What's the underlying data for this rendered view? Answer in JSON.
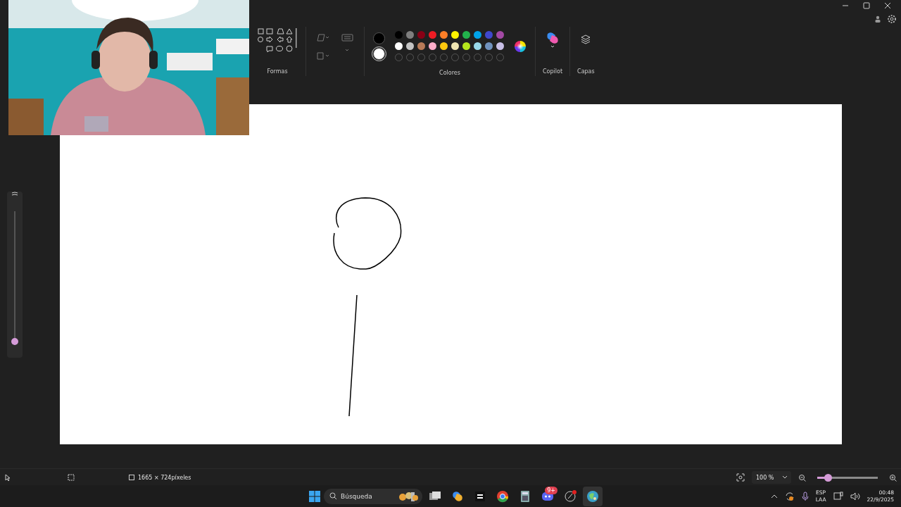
{
  "ribbon": {
    "shapes": {
      "label": "Formas"
    },
    "colors": {
      "label": "Colores",
      "current": [
        {
          "color": "#000000"
        },
        {
          "color": "#ffffff"
        }
      ],
      "palette": [
        {
          "color": "#000000"
        },
        {
          "color": "#7f7f7f"
        },
        {
          "color": "#880015"
        },
        {
          "color": "#ed1c24"
        },
        {
          "color": "#ff7f27"
        },
        {
          "color": "#fff200"
        },
        {
          "color": "#22b14c"
        },
        {
          "color": "#00a2e8"
        },
        {
          "color": "#3f48cc"
        },
        {
          "color": "#a349a4"
        },
        {
          "color": "#ffffff"
        },
        {
          "color": "#c3c3c3"
        },
        {
          "color": "#b97a57"
        },
        {
          "color": "#ffaec9"
        },
        {
          "color": "#ffc90e"
        },
        {
          "color": "#efe4b0"
        },
        {
          "color": "#b5e61d"
        },
        {
          "color": "#99d9ea"
        },
        {
          "color": "#7092be"
        },
        {
          "color": "#c8bfe7"
        }
      ]
    },
    "copilot": {
      "label": "Copilot"
    },
    "layers": {
      "label": "Capas"
    }
  },
  "brush_slider": {
    "level": 0.0
  },
  "status_bar": {
    "canvas_size": "1665 × 724píxeles",
    "zoom": "100 %",
    "zoom_level": {
      "level": 0.18
    }
  },
  "taskbar": {
    "search": {
      "placeholder": "Búsqueda"
    },
    "apps": [
      {
        "kind": "taskview",
        "active": false
      },
      {
        "kind": "copilot",
        "active": false
      },
      {
        "kind": "blocks",
        "active": false
      },
      {
        "kind": "browser",
        "active": false
      },
      {
        "kind": "calculator",
        "active": false
      },
      {
        "kind": "chat",
        "active": false,
        "badge": "9+"
      },
      {
        "kind": "clock",
        "active": false
      },
      {
        "kind": "paint",
        "active": true
      }
    ],
    "tray": {
      "language": [
        "ESP",
        "LAA"
      ],
      "time": "00:48",
      "date": "22/9/2025"
    }
  }
}
